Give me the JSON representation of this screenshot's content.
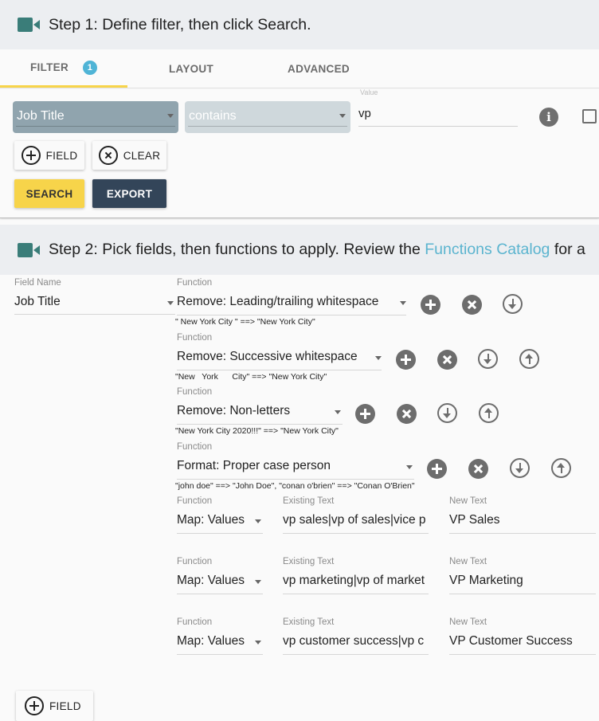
{
  "step1": {
    "title": "Step 1: Define filter, then click Search.",
    "icon": "video-camera-icon"
  },
  "tabs": [
    {
      "label": "FILTER",
      "badge": "1",
      "active": true
    },
    {
      "label": "LAYOUT",
      "active": false
    },
    {
      "label": "ADVANCED",
      "active": false
    }
  ],
  "filter": {
    "field_value": "Job Title",
    "operator_value": "contains",
    "value_label": "Value",
    "value": "vp",
    "info_icon": "i",
    "add_field_label": "FIELD",
    "clear_label": "CLEAR",
    "search_label": "SEARCH",
    "export_label": "EXPORT"
  },
  "step2": {
    "title_prefix": "Step 2: Pick fields, then functions to apply. Review the ",
    "link_text": "Functions Catalog",
    "title_suffix": " for a",
    "link_color": "#5bb4cf"
  },
  "fields": {
    "field_name_label": "Field Name",
    "field_name_value": "Job Title",
    "function_label": "Function",
    "existing_label": "Existing Text",
    "new_label": "New Text",
    "functions": [
      {
        "value": "Remove: Leading/trailing whitespace",
        "example": "\" New York City \" ==> \"New York City\""
      },
      {
        "value": "Remove: Successive whitespace",
        "example": "\"New   York      City\" ==> \"New York City\""
      },
      {
        "value": "Remove: Non-letters",
        "example": "\"New York City 2020!!!\" ==> \"New York City\""
      },
      {
        "value": "Format: Proper case person",
        "example": "\"john doe\" ==> \"John Doe\", \"conan o'brien\" ==> \"Conan O'Brien\""
      }
    ],
    "maps": [
      {
        "function": "Map: Values",
        "existing": "vp sales|vp of sales|vice p",
        "new": "VP Sales"
      },
      {
        "function": "Map: Values",
        "existing": "vp marketing|vp of market",
        "new": "VP Marketing"
      },
      {
        "function": "Map: Values",
        "existing": "vp customer success|vp c",
        "new": "VP Customer Success"
      }
    ],
    "add_field_label": "FIELD"
  },
  "colors": {
    "accent_yellow": "#f7d44a",
    "navy": "#334559",
    "teal_icon": "#3a7d79",
    "badge": "#4fb4d6"
  }
}
